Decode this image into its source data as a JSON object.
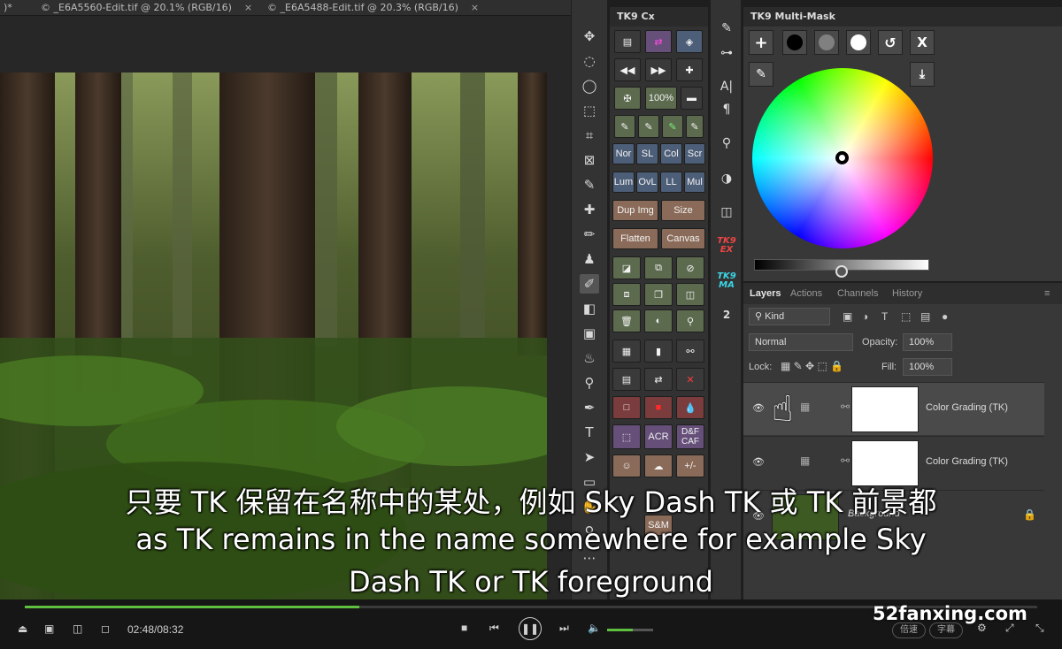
{
  "doc_tabs": [
    {
      "label": ")*",
      "close": "×"
    },
    {
      "label": "© _E6A5560-Edit.tif @ 20.1% (RGB/16)",
      "close": "×"
    },
    {
      "label": "© _E6A5488-Edit.tif @ 20.3% (RGB/16)",
      "close": "×"
    }
  ],
  "cx_panel": {
    "title": "TK9 Cx",
    "zoom_label": "100%",
    "blend_row1": [
      "Nor",
      "SL",
      "Col",
      "Scr"
    ],
    "blend_row2": [
      "Lum",
      "OvL",
      "LL",
      "Mul"
    ],
    "dup_img": "Dup Img",
    "size": "Size",
    "flatten": "Flatten",
    "canvas": "Canvas",
    "acr": "ACR",
    "df_caf": "D&F CAF",
    "plus_minus": "+/-",
    "sm": "S&M"
  },
  "strip": {
    "tk9_ex": "TK9 EX",
    "tk9_ma": "TK9 MA",
    "two": "2"
  },
  "multimask": {
    "title": "TK9 Multi-Mask",
    "buttons": [
      "+",
      "X"
    ]
  },
  "layers_panel": {
    "tabs": [
      "Layers",
      "Actions",
      "Channels",
      "History"
    ],
    "kind": "Kind",
    "blend_mode": "Normal",
    "opacity_label": "Opacity:",
    "opacity_value": "100%",
    "lock_label": "Lock:",
    "fill_label": "Fill:",
    "fill_value": "100%",
    "layers": [
      {
        "name": "Color Grading (TK)"
      },
      {
        "name": "Color Grading (TK)"
      },
      {
        "name": "Background"
      }
    ]
  },
  "subtitles": {
    "line1": "只要 TK 保留在名称中的某处，例如 Sky Dash TK 或 TK 前景都",
    "line2": "as TK remains in the name somewhere for example Sky",
    "line3": "Dash TK or TK foreground"
  },
  "player": {
    "time": "02:48/08:32",
    "progress": 0.33,
    "volume": 0.55,
    "speed_btn": "倍速",
    "subtitle_btn": "字幕",
    "watermark": "52fanxing.com"
  },
  "colors": {
    "accent": "#5fbf3f",
    "panel": "#383838"
  }
}
